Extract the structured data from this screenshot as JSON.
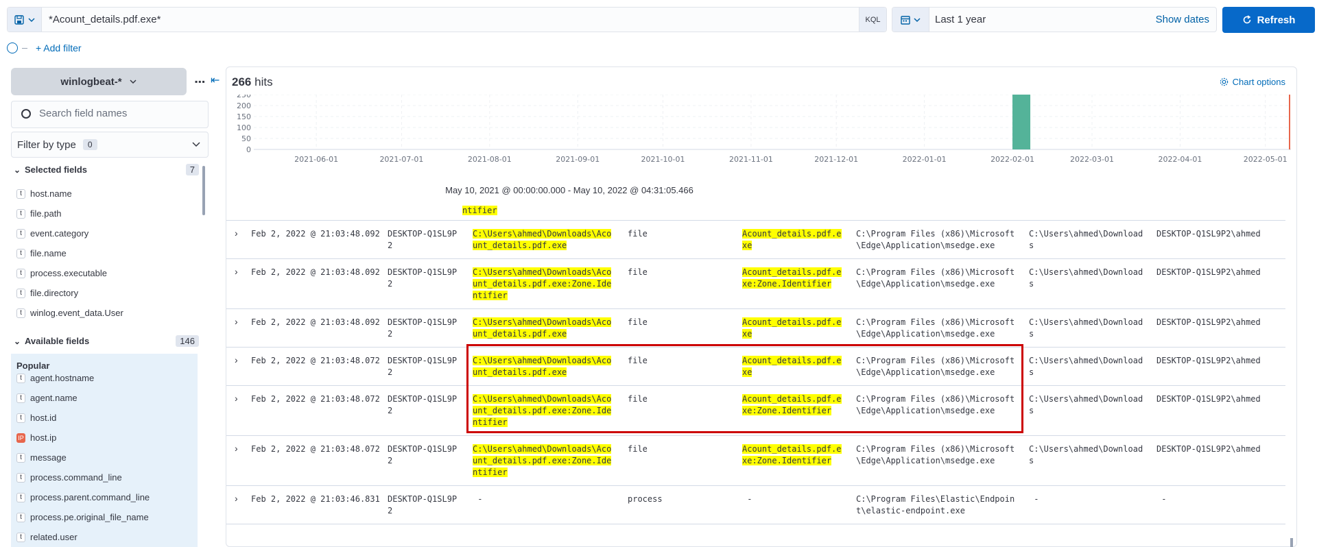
{
  "query": {
    "text": "*Acount_details.pdf.exe*",
    "language": "KQL"
  },
  "time": {
    "label": "Last 1 year",
    "show_dates": "Show dates",
    "refresh": "Refresh"
  },
  "filters": {
    "add_filter": "+ Add filter"
  },
  "sidebar": {
    "index_pattern": "winlogbeat-*",
    "search_placeholder": "Search field names",
    "filter_by_type": "Filter by type",
    "filter_count": "0",
    "selected_header": "Selected fields",
    "selected_count": "7",
    "selected_fields": [
      {
        "type": "t",
        "name": "host.name"
      },
      {
        "type": "t",
        "name": "file.path"
      },
      {
        "type": "t",
        "name": "event.category"
      },
      {
        "type": "t",
        "name": "file.name"
      },
      {
        "type": "t",
        "name": "process.executable"
      },
      {
        "type": "t",
        "name": "file.directory"
      },
      {
        "type": "t",
        "name": "winlog.event_data.User"
      }
    ],
    "available_header": "Available fields",
    "available_count": "146",
    "popular_label": "Popular",
    "popular_fields": [
      {
        "type": "t",
        "name": "agent.hostname"
      },
      {
        "type": "t",
        "name": "agent.name"
      },
      {
        "type": "t",
        "name": "host.id"
      },
      {
        "type": "ip",
        "name": "host.ip"
      },
      {
        "type": "t",
        "name": "message"
      },
      {
        "type": "t",
        "name": "process.command_line"
      },
      {
        "type": "t",
        "name": "process.parent.command_line"
      },
      {
        "type": "t",
        "name": "process.pe.original_file_name"
      },
      {
        "type": "t",
        "name": "related.user"
      }
    ]
  },
  "main": {
    "hits_count": "266",
    "hits_label": "hits",
    "chart_options": "Chart options",
    "date_range": "May 10, 2021 @ 00:00:00.000 - May 10, 2022 @ 04:31:05.466"
  },
  "chart_data": {
    "type": "bar",
    "x": [
      "2021-06-01",
      "2021-07-01",
      "2021-08-01",
      "2021-09-01",
      "2021-10-01",
      "2021-11-01",
      "2021-12-01",
      "2022-01-01",
      "2022-02-01",
      "2022-03-01",
      "2022-04-01",
      "2022-05-01"
    ],
    "series": [
      {
        "values": [
          {
            "x": "2022-02-01",
            "y": 250
          }
        ]
      }
    ],
    "ylim": [
      0,
      250
    ],
    "yticks": [
      250,
      200,
      150,
      100,
      50,
      0
    ],
    "now_marker": "2022-05-10",
    "colors": {
      "bar": "#54b399",
      "marker": "#e7664c"
    }
  },
  "table": {
    "partial_first": "ntifier",
    "rows": [
      {
        "time": "Feb 2, 2022 @ 21:03:48.092",
        "host": "DESKTOP-Q1SL9P\n2",
        "path": "C:\\Users\\ahmed\\Downloads\\Aco\nunt_details.pdf.exe",
        "path_hl": true,
        "category": "file",
        "fname": "Acount_details.pdf.e\nxe",
        "fname_hl": true,
        "exe": "C:\\Program Files (x86)\\Microsoft\n\\Edge\\Application\\msedge.exe",
        "dir": "C:\\Users\\ahmed\\Download\ns",
        "user": "DESKTOP-Q1SL9P2\\ahmed"
      },
      {
        "time": "Feb 2, 2022 @ 21:03:48.092",
        "host": "DESKTOP-Q1SL9P\n2",
        "path": "C:\\Users\\ahmed\\Downloads\\Aco\nunt_details.pdf.exe:Zone.Ide\nntifier",
        "path_hl": true,
        "category": "file",
        "fname": "Acount_details.pdf.e\nxe:Zone.Identifier",
        "fname_hl": true,
        "exe": "C:\\Program Files (x86)\\Microsoft\n\\Edge\\Application\\msedge.exe",
        "dir": "C:\\Users\\ahmed\\Download\ns",
        "user": "DESKTOP-Q1SL9P2\\ahmed"
      },
      {
        "time": "Feb 2, 2022 @ 21:03:48.092",
        "host": "DESKTOP-Q1SL9P\n2",
        "path": "C:\\Users\\ahmed\\Downloads\\Aco\nunt_details.pdf.exe",
        "path_hl": true,
        "category": "file",
        "fname": "Acount_details.pdf.e\nxe",
        "fname_hl": true,
        "exe": "C:\\Program Files (x86)\\Microsoft\n\\Edge\\Application\\msedge.exe",
        "dir": "C:\\Users\\ahmed\\Download\ns",
        "user": "DESKTOP-Q1SL9P2\\ahmed"
      },
      {
        "time": "Feb 2, 2022 @ 21:03:48.072",
        "host": "DESKTOP-Q1SL9P\n2",
        "path": "C:\\Users\\ahmed\\Downloads\\Aco\nunt_details.pdf.exe",
        "path_hl": true,
        "category": "file",
        "fname": "Acount_details.pdf.e\nxe",
        "fname_hl": true,
        "exe": "C:\\Program Files (x86)\\Microsoft\n\\Edge\\Application\\msedge.exe",
        "dir": "C:\\Users\\ahmed\\Download\ns",
        "user": "DESKTOP-Q1SL9P2\\ahmed"
      },
      {
        "time": "Feb 2, 2022 @ 21:03:48.072",
        "host": "DESKTOP-Q1SL9P\n2",
        "path": "C:\\Users\\ahmed\\Downloads\\Aco\nunt_details.pdf.exe:Zone.Ide\nntifier",
        "path_hl": true,
        "category": "file",
        "fname": "Acount_details.pdf.e\nxe:Zone.Identifier",
        "fname_hl": true,
        "exe": "C:\\Program Files (x86)\\Microsoft\n\\Edge\\Application\\msedge.exe",
        "dir": "C:\\Users\\ahmed\\Download\ns",
        "user": "DESKTOP-Q1SL9P2\\ahmed"
      },
      {
        "time": "Feb 2, 2022 @ 21:03:48.072",
        "host": "DESKTOP-Q1SL9P\n2",
        "path": "C:\\Users\\ahmed\\Downloads\\Aco\nunt_details.pdf.exe:Zone.Ide\nntifier",
        "path_hl": true,
        "category": "file",
        "fname": "Acount_details.pdf.e\nxe:Zone.Identifier",
        "fname_hl": true,
        "exe": "C:\\Program Files (x86)\\Microsoft\n\\Edge\\Application\\msedge.exe",
        "dir": "C:\\Users\\ahmed\\Download\ns",
        "user": "DESKTOP-Q1SL9P2\\ahmed"
      },
      {
        "time": "Feb 2, 2022 @ 21:03:46.831",
        "host": "DESKTOP-Q1SL9P\n2",
        "path": " -",
        "path_hl": false,
        "category": "process",
        "fname": " -",
        "fname_hl": false,
        "exe": "C:\\Program Files\\Elastic\\Endpoin\nt\\elastic-endpoint.exe",
        "dir": " -",
        "user": " -"
      }
    ]
  }
}
